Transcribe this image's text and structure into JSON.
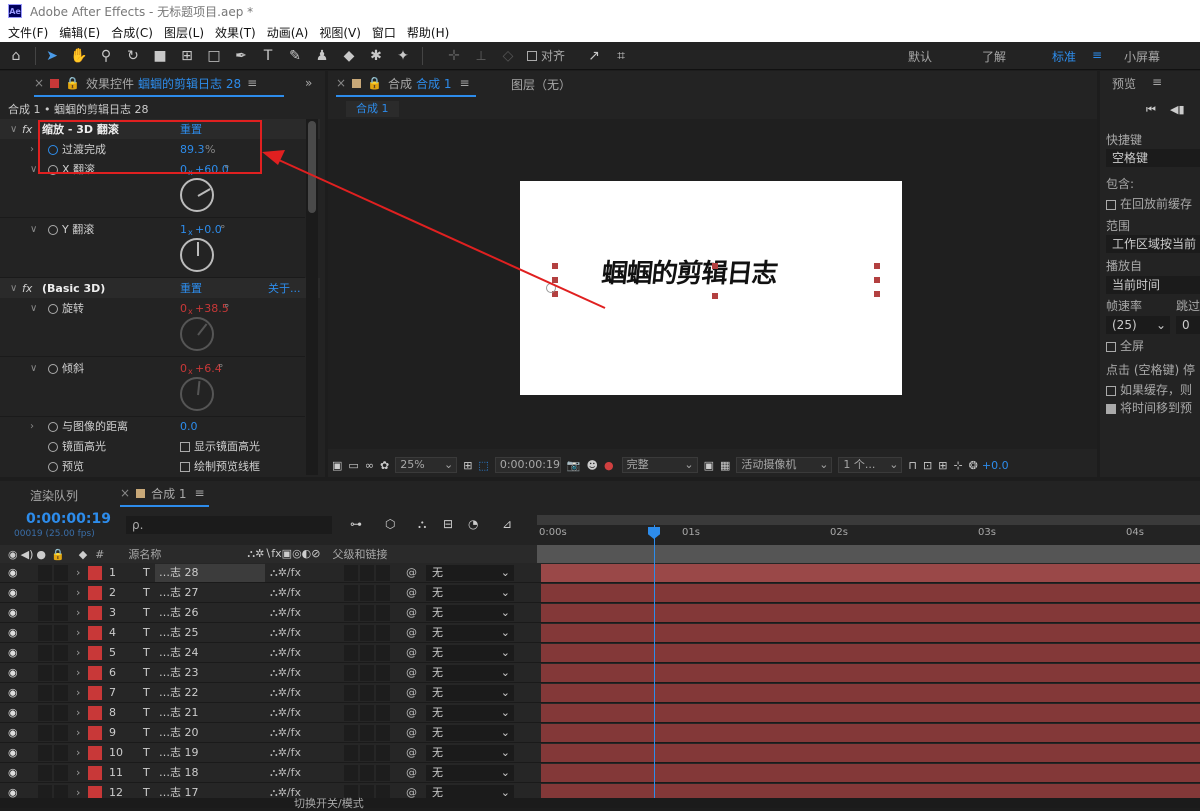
{
  "window": {
    "title": "Adobe After Effects - 无标题项目.aep *"
  },
  "menu": [
    "文件(F)",
    "编辑(E)",
    "合成(C)",
    "图层(L)",
    "效果(T)",
    "动画(A)",
    "视图(V)",
    "窗口",
    "帮助(H)"
  ],
  "toolbar": {
    "align_label": "对齐",
    "workspaces": [
      "默认",
      "了解",
      "标准",
      "小屏幕"
    ],
    "active_workspace": "标准"
  },
  "effects_panel": {
    "tab_label": "效果控件",
    "tab_layer": "蝈蝈的剪辑日志 28",
    "breadcrumb": "合成 1 • 蝈蝈的剪辑日志 28",
    "effect1": {
      "fx": "fx",
      "name": "缩放 - 3D 翻滚",
      "reset": "重置",
      "p1_label": "过渡完成",
      "p1_value": "89.3",
      "p1_unit": "%",
      "p2_label": "X 翻滚",
      "p2_rev": "0",
      "p2_x": "x",
      "p2_value": "+60.0",
      "p2_unit": "°",
      "p3_label": "Y 翻滚",
      "p3_rev": "1",
      "p3_x": "x",
      "p3_value": "+0.0",
      "p3_unit": "°"
    },
    "effect2": {
      "fx": "fx",
      "name": "(Basic 3D)",
      "reset": "重置",
      "about": "关于...",
      "p1_label": "旋转",
      "p1_rev": "0",
      "p1_x": "x",
      "p1_value": "+38.5",
      "p1_unit": "°",
      "p2_label": "倾斜",
      "p2_rev": "0",
      "p2_x": "x",
      "p2_value": "+6.4",
      "p2_unit": "°",
      "p3_label": "与图像的距离",
      "p3_value": "0.0",
      "p4_label": "镜面高光",
      "p4_check": "显示镜面高光",
      "p5_label": "预览",
      "p5_check": "绘制预览线框"
    }
  },
  "comp_panel": {
    "tab_label": "合成",
    "tab_comp": "合成 1",
    "layer_tab": "图层（无）",
    "subtab": "合成 1",
    "canvas_text": "蝈蝈的剪辑日志",
    "footer": {
      "zoom": "25%",
      "timecode": "0:00:00:19",
      "quality": "完整",
      "camera": "活动摄像机",
      "views": "1 个...",
      "exposure": "+0.0"
    }
  },
  "preview_panel": {
    "title": "预览",
    "shortcut_label": "快捷键",
    "shortcut_value": "空格键",
    "include_label": "包含:",
    "cache_label": "在回放前缓存",
    "range_label": "范围",
    "range_value": "工作区域按当前",
    "play_from_label": "播放自",
    "play_from_value": "当前时间",
    "fps_label": "帧速率",
    "skip_label": "跳过",
    "fps_value": "(25)",
    "skip_value": "0",
    "fullscreen_label": "全屏",
    "click_label": "点击 (空格键) 停",
    "if_cached_label": "如果缓存，则",
    "move_time_label": "将时间移到预"
  },
  "timeline": {
    "tab_render": "渲染队列",
    "tab_comp": "合成 1",
    "timecode": "0:00:00:19",
    "frame_info": "00019 (25.00 fps)",
    "search_placeholder": "ρ.",
    "col_num": "#",
    "col_source": "源名称",
    "col_parent": "父级和链接",
    "ruler": [
      "0:00s",
      "01s",
      "02s",
      "03s",
      "04s"
    ],
    "footer_label": "切换开关/模式",
    "layers": [
      {
        "num": "1",
        "type": "T",
        "name": "…志 28",
        "parent": "无"
      },
      {
        "num": "2",
        "type": "T",
        "name": "…志 27",
        "parent": "无"
      },
      {
        "num": "3",
        "type": "T",
        "name": "…志 26",
        "parent": "无"
      },
      {
        "num": "4",
        "type": "T",
        "name": "…志 25",
        "parent": "无"
      },
      {
        "num": "5",
        "type": "T",
        "name": "…志 24",
        "parent": "无"
      },
      {
        "num": "6",
        "type": "T",
        "name": "…志 23",
        "parent": "无"
      },
      {
        "num": "7",
        "type": "T",
        "name": "…志 22",
        "parent": "无"
      },
      {
        "num": "8",
        "type": "T",
        "name": "…志 21",
        "parent": "无"
      },
      {
        "num": "9",
        "type": "T",
        "name": "…志 20",
        "parent": "无"
      },
      {
        "num": "10",
        "type": "T",
        "name": "…志 19",
        "parent": "无"
      },
      {
        "num": "11",
        "type": "T",
        "name": "…志 18",
        "parent": "无"
      },
      {
        "num": "12",
        "type": "T",
        "name": "…志 17",
        "parent": "无"
      }
    ]
  },
  "colors": {
    "accent": "#2d8ceb",
    "annotation": "#e02020",
    "label_red": "#c83838",
    "bar": "#833838"
  }
}
